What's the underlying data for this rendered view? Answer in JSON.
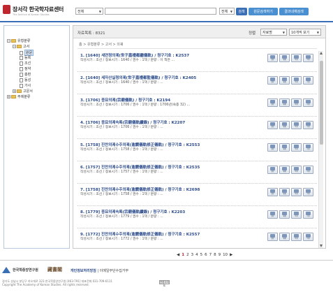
{
  "header": {
    "logo_text": "장서각 한국학자료센터",
    "logo_sub": "The Archive of Korean Studies",
    "scope_select": "전체",
    "field_select": "전체",
    "search_button": "검색",
    "detail_search_button": "원문검색하기",
    "result_search_button": "결과내재검색",
    "brand_color": "#c0262d",
    "accent_color": "#3a6fb5"
  },
  "sidebar": {
    "items": [
      {
        "label": "유형분류",
        "level": 0
      },
      {
        "label": "고서",
        "level": 1
      },
      {
        "label": "원문",
        "level": 2
      },
      {
        "label": "등록",
        "level": 2
      },
      {
        "label": "조선",
        "level": 2
      },
      {
        "label": "정약",
        "level": 2
      },
      {
        "label": "총편",
        "level": 2
      },
      {
        "label": "동성",
        "level": 2
      },
      {
        "label": "가사",
        "level": 2
      },
      {
        "label": "고문서",
        "level": 1
      },
      {
        "label": "주제분류",
        "level": 0
      }
    ]
  },
  "main": {
    "count_label": "자료목록 : 8321",
    "sort_label": "정렬",
    "sort_select": "자료명",
    "page_size_select": "10개씩 보기",
    "breadcrumb": "홈 > 유형분류 > 고서 > 의궤",
    "results": [
      {
        "title": "1. [1640] 세연청의궤(世子嘉禮都廳儀軌) / 청구기호 : K2537",
        "meta": "작성시기 : 조선 / 정보시기 : 1640 / 권수 : 1책 / 분량 : 이 책은 ..."
      },
      {
        "title": "2. [1640] 세자산실청의궤(世子嘉禮都監儀軌) / 청구기호 : K2405",
        "meta": "작성시기 : 조선 / 정보시기 : 1640 / 권수 : 1책 / 분량 : ..."
      },
      {
        "title": "3. [1706] 종묘의궤(宗廟儀軌) / 청구기호 : K2194",
        "meta": "작성시기 : 조선 / 정보시기 : 1706 / 권수 : 1책 / 분량 : 1706년(숙종 32) ..."
      },
      {
        "title": "4. [1706] 종묘의궤속록(宗廟儀軌續錄) / 청구기호 : K2207",
        "meta": "작성시기 : 조선 / 정보시기 : 1706 / 권수 : 1책 / 분량 : ..."
      },
      {
        "title": "5. [1758] 진찬의궤수주의궤(進饌儀軌修正儀軌) / 청구기호 : K2553",
        "meta": "작성시기 : 조선 / 정보시기 : 1758 / 권수 : 1책 / 분량 : ..."
      },
      {
        "title": "6. [1757] 진찬의궤수주의궤(進饌儀軌修正儀軌) / 청구기호 : K2535",
        "meta": "작성시기 : 조선 / 정보시기 : 1757 / 권수 : 1책 / 분량 : ..."
      },
      {
        "title": "7. [1758] 진찬의궤수주의궤(進饌儀軌修正儀軌) / 청구기호 : K2698",
        "meta": "작성시기 : 조선 / 정보시기 : 1758 / 권수 : 1책 / 분량 : ..."
      },
      {
        "title": "8. [1779] 종묘의궤속록(宗廟儀軌續錄) / 청구기호 : K2203",
        "meta": "작성시기 : 조선 / 정보시기 : 1779 / 권수 : 1책 / 분량 : ..."
      },
      {
        "title": "9. [1772] 진찬의궤수주의궤(進饌儀軌修正儀軌) / 청구기호 : K2557",
        "meta": "작성시기 : 조선 / 정보시기 : 1772 / 권수 : 1책 / 분량 : ..."
      }
    ],
    "icon_labels": [
      "원문",
      "해제",
      "목차",
      "서지"
    ]
  },
  "pager": {
    "prev": "◀",
    "pages": [
      "1",
      "2",
      "3",
      "4",
      "5",
      "6",
      "7",
      "8",
      "9",
      "10"
    ],
    "next": "▶"
  },
  "footer": {
    "logo1": "한국학중앙연구원",
    "logo2": "藏書閣",
    "links_bold": "개인정보처리방침",
    "links_rest": "| 이메일무단수집거부",
    "address": "경기도 성남시 분당구 하오개로 323 한국학중앙연구원 [463-791] 대표전화 031-709-6111",
    "copyright": "Copyright The Academy of Korean Studies. All rights reserved.",
    "site_button": "관련사이트"
  }
}
